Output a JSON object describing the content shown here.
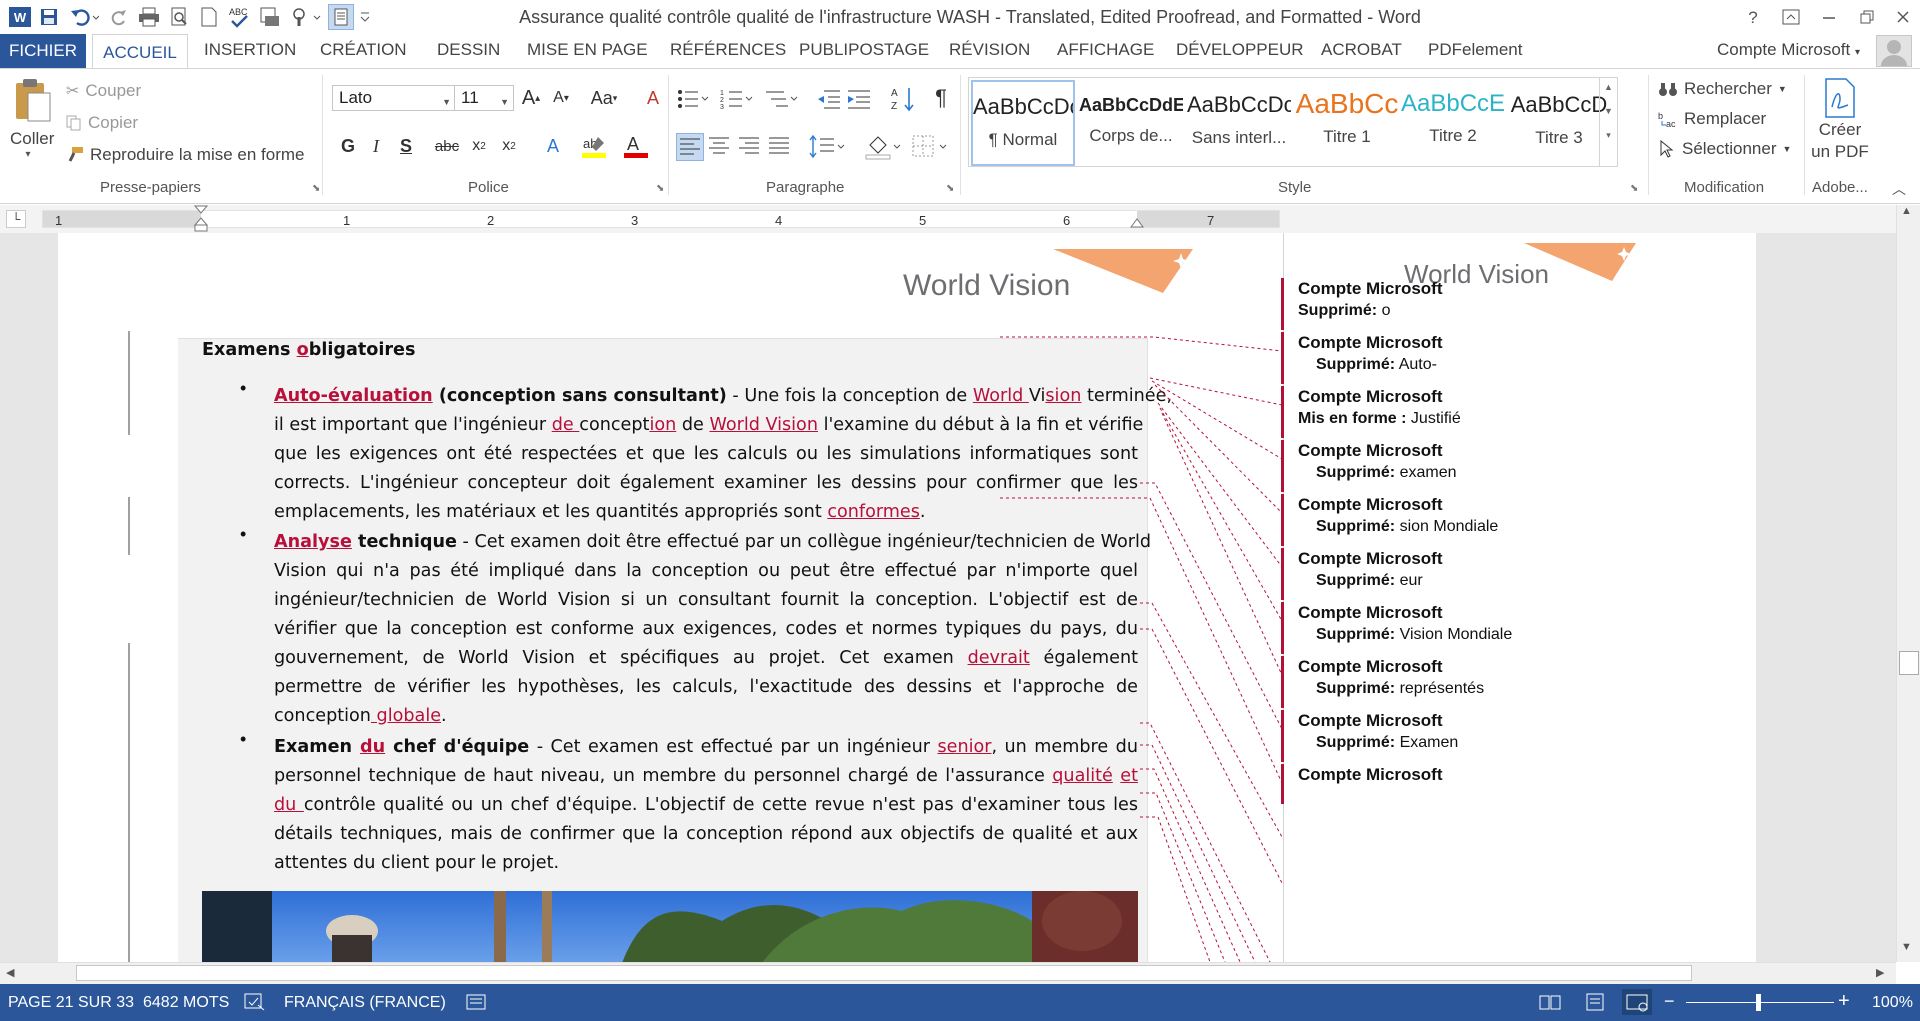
{
  "window": {
    "title": "Assurance qualité  contrôle qualité de l'infrastructure WASH - Translated, Edited Proofread, and Formatted - Word"
  },
  "tabs": {
    "file": "FICHIER",
    "items": [
      "ACCUEIL",
      "INSERTION",
      "CRÉATION",
      "DESSIN",
      "MISE EN PAGE",
      "RÉFÉRENCES",
      "PUBLIPOSTAGE",
      "RÉVISION",
      "AFFICHAGE",
      "DÉVELOPPEUR",
      "ACROBAT",
      "PDFelement"
    ],
    "account": "Compte Microsoft"
  },
  "ribbon": {
    "clipboard": {
      "paste": "Coller",
      "cut": "Couper",
      "copy": "Copier",
      "format_painter": "Reproduire la mise en forme",
      "label": "Presse-papiers"
    },
    "font": {
      "name": "Lato",
      "size": "11",
      "label": "Police"
    },
    "paragraph": {
      "label": "Paragraphe"
    },
    "styles": {
      "items": [
        {
          "preview": "AaBbCcDc",
          "name": "¶ Normal",
          "color": "#222222"
        },
        {
          "preview": "AaBbCcDdE",
          "name": "Corps de...",
          "color": "#222222"
        },
        {
          "preview": "AaBbCcDc",
          "name": "Sans interl...",
          "color": "#222222"
        },
        {
          "preview": "AaBbCc",
          "name": "Titre 1",
          "color": "#e8741d"
        },
        {
          "preview": "AaBbCcE",
          "name": "Titre 2",
          "color": "#2bb4c8"
        },
        {
          "preview": "AaBbCcD",
          "name": "Titre 3",
          "color": "#222222"
        }
      ],
      "label": "Style"
    },
    "editing": {
      "find": "Rechercher",
      "replace": "Remplacer",
      "select": "Sélectionner",
      "label": "Modification"
    },
    "adobe": {
      "create_pdf_line1": "Créer",
      "create_pdf_line2": "un PDF",
      "label": "Adobe..."
    }
  },
  "ruler": {
    "numbers": [
      "1",
      "1",
      "2",
      "3",
      "4",
      "5",
      "6",
      "7"
    ]
  },
  "document": {
    "logo_text": "World Vision",
    "heading": {
      "pre": "Examens ",
      "ins": "o",
      "post": "bligatoires"
    },
    "bullets": [
      {
        "line1": {
          "ins_title": "Auto-évaluation",
          "bold": " (conception sans consultant)",
          "t1": " - Une fois la conception de ",
          "ins1": "World ",
          "t2": "Vi",
          "ins2": "sion",
          "t3": " terminée,"
        },
        "line2": {
          "t1": "il est important que l'ingénieur ",
          "ins1": "de ",
          "t2": "concept",
          "ins2": "ion",
          "t3": " de ",
          "ins3": "World Vision",
          "t4": " l'examine du début à la fin et vérifie"
        },
        "line3": "que les exigences ont été respectées et que les calculs ou les simulations informatiques sont",
        "line4": "corrects. L'ingénieur concepteur doit également examiner les dessins pour confirmer que les",
        "line5": {
          "t1": "emplacements, les matériaux et les quantités appropriés sont ",
          "ins1": "conformes",
          "t2": "."
        }
      },
      {
        "line1": {
          "ins_title": "Analyse",
          "bold": " technique",
          "t1": " - Cet examen doit être effectué par un collègue ingénieur/technicien de World"
        },
        "line2": "Vision qui n'a pas été impliqué dans la conception ou peut être effectué par n'importe quel",
        "line3": "ingénieur/technicien de World Vision si un consultant fournit la conception. L'objectif est de",
        "line4": "vérifier que la conception est conforme aux exigences, codes et normes typiques du pays, du",
        "line5": {
          "t1": "gouvernement, de World Vision et spécifiques au projet. Cet examen ",
          "ins1": "devrait",
          "t2": " également"
        },
        "line6": "permettre de vérifier les hypothèses, les calculs, l'exactitude des dessins et l'approche de",
        "line7": {
          "t1": "conception",
          "ins1": " globale",
          "t2": "."
        }
      },
      {
        "line1": {
          "b1": "Examen ",
          "ins_b": "du",
          "b2": " chef d'équipe",
          "t1": " - Cet examen est effectué par un ingénieur ",
          "ins1": "senior",
          "t2": ", un membre du"
        },
        "line2": {
          "t1": "personnel technique de haut niveau, un membre du personnel chargé de l'assurance ",
          "ins1": "qualité",
          "t2": " ",
          "ins2": "et"
        },
        "line3": {
          "ins1": "du ",
          "t1": "contrôle qualité ou un chef d'équipe. L'objectif de cette revue n'est pas d'examiner tous les"
        },
        "line4": "détails techniques, mais de confirmer que la conception répond aux objectifs de qualité et aux",
        "line5": "attentes du client pour le projet."
      }
    ]
  },
  "comments": [
    {
      "author": "Compte Microsoft",
      "label": "Supprimé:",
      "value": "o",
      "indent": false
    },
    {
      "author": "Compte Microsoft",
      "label": "Supprimé:",
      "value": "Auto-",
      "indent": true
    },
    {
      "author": "Compte Microsoft",
      "label": "Mis en forme :",
      "value": "Justifié",
      "indent": false
    },
    {
      "author": "Compte Microsoft",
      "label": "Supprimé:",
      "value": "examen",
      "indent": true
    },
    {
      "author": "Compte Microsoft",
      "label": "Supprimé:",
      "value": "sion Mondiale",
      "indent": true
    },
    {
      "author": "Compte Microsoft",
      "label": "Supprimé:",
      "value": "eur",
      "indent": true
    },
    {
      "author": "Compte Microsoft",
      "label": "Supprimé:",
      "value": "Vision Mondiale",
      "indent": true
    },
    {
      "author": "Compte Microsoft",
      "label": "Supprimé:",
      "value": "représentés",
      "indent": true
    },
    {
      "author": "Compte Microsoft",
      "label": "Supprimé:",
      "value": "Examen",
      "indent": true
    },
    {
      "author": "Compte Microsoft",
      "label": "",
      "value": "",
      "indent": true
    }
  ],
  "status": {
    "page": "PAGE 21 SUR 33",
    "words": "6482 MOTS",
    "language": "FRANÇAIS (FRANCE)",
    "zoom": "100%"
  },
  "colors": {
    "brand": "#2b579a",
    "revision": "#b8103a",
    "logo_orange": "#f4a46f"
  }
}
